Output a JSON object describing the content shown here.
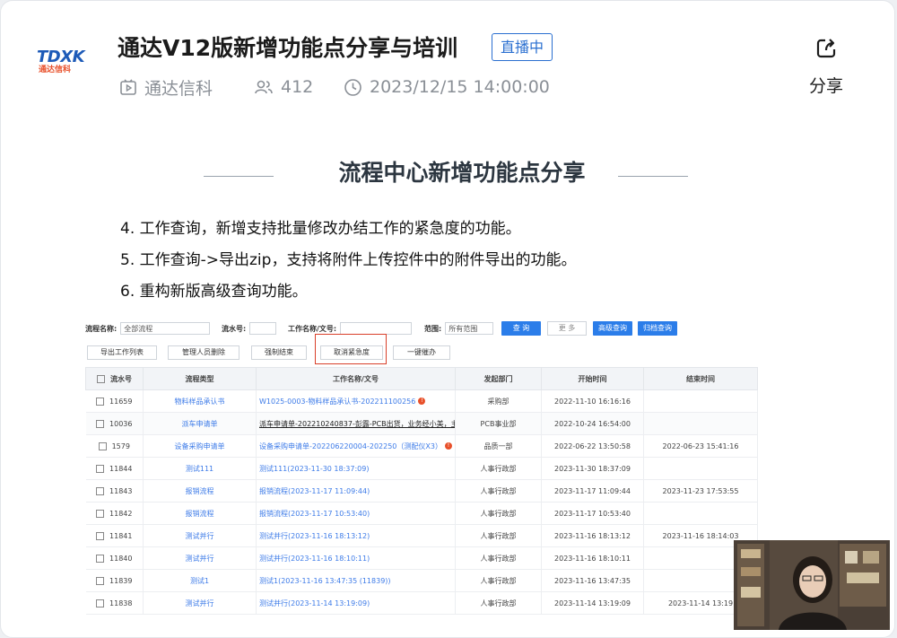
{
  "header": {
    "logo_text": "TDXK",
    "logo_sub": "通达信科",
    "title": "通达V12版新增功能点分享与培训",
    "live_badge": "直播中",
    "channel": "通达信科",
    "viewers": "412",
    "datetime": "2023/12/15 14:00:00",
    "share_label": "分享"
  },
  "slide": {
    "title": "流程中心新增功能点分享",
    "points": [
      "4. 工作查询，新增支持批量修改办结工作的紧急度的功能。",
      "5. 工作查询->导出zip，支持将附件上传控件中的附件导出的功能。",
      "6. 重构新版高级查询功能。"
    ]
  },
  "screenshot": {
    "search": {
      "flow_name_label": "流程名称:",
      "flow_name_value": "全部流程",
      "serial_label": "流水号:",
      "work_name_label": "工作名称/文号:",
      "scope_label": "范围:",
      "scope_value": "所有范围",
      "query_btn": "查 询",
      "more_btn": "更 多",
      "adv_btn": "高级查询",
      "archive_btn": "归档查询"
    },
    "actions": [
      "导出工作列表",
      "管理人员删除",
      "强制结束",
      "取消紧急度",
      "一键催办"
    ],
    "columns": [
      "流水号",
      "流程类型",
      "工作名称/文号",
      "发起部门",
      "开始时间",
      "结束时间"
    ],
    "rows": [
      {
        "id": "11659",
        "type": "物料样品承认书",
        "name": "W1025-0003-物料样品承认书-202211100256",
        "dept": "采购部",
        "start": "2022-11-10 16:16:16",
        "end": "",
        "badge": true,
        "dark": false
      },
      {
        "id": "10036",
        "type": "派车申请单",
        "name": "派车申请单-202210240837-彭露-PCB出货，业务经小美，主",
        "dept": "PCB事业部",
        "start": "2022-10-24 16:54:00",
        "end": "",
        "badge": false,
        "dark": true
      },
      {
        "id": "1579",
        "type": "设备采购申请单",
        "name": "设备采购申请单-202206220004-202250（测配仪X3）",
        "dept": "品质一部",
        "start": "2022-06-22 13:50:58",
        "end": "2022-06-23 15:41:16",
        "badge": true,
        "dark": false
      },
      {
        "id": "11844",
        "type": "测试111",
        "name": "测试111(2023-11-30 18:37:09)",
        "dept": "人事行政部",
        "start": "2023-11-30 18:37:09",
        "end": "",
        "badge": false,
        "dark": false
      },
      {
        "id": "11843",
        "type": "报销流程",
        "name": "报销流程(2023-11-17 11:09:44)",
        "dept": "人事行政部",
        "start": "2023-11-17 11:09:44",
        "end": "2023-11-23 17:53:55",
        "badge": false,
        "dark": false
      },
      {
        "id": "11842",
        "type": "报销流程",
        "name": "报销流程(2023-11-17 10:53:40)",
        "dept": "人事行政部",
        "start": "2023-11-17 10:53:40",
        "end": "",
        "badge": false,
        "dark": false
      },
      {
        "id": "11841",
        "type": "测试并行",
        "name": "测试并行(2023-11-16 18:13:12)",
        "dept": "人事行政部",
        "start": "2023-11-16 18:13:12",
        "end": "2023-11-16 18:14:03",
        "badge": false,
        "dark": false
      },
      {
        "id": "11840",
        "type": "测试并行",
        "name": "测试并行(2023-11-16 18:10:11)",
        "dept": "人事行政部",
        "start": "2023-11-16 18:10:11",
        "end": "",
        "badge": false,
        "dark": false
      },
      {
        "id": "11839",
        "type": "测试1",
        "name": "测试1(2023-11-16 13:47:35 (11839))",
        "dept": "人事行政部",
        "start": "2023-11-16 13:47:35",
        "end": "",
        "badge": false,
        "dark": false
      },
      {
        "id": "11838",
        "type": "测试并行",
        "name": "测试并行(2023-11-14 13:19:09)",
        "dept": "人事行政部",
        "start": "2023-11-14 13:19:09",
        "end": "2023-11-14 13:19",
        "badge": false,
        "dark": false
      }
    ]
  },
  "colors": {
    "accent": "#2a6fd0",
    "link": "#3d7be8",
    "highlight": "#d9402a"
  },
  "icons": [
    "play-icon",
    "users-icon",
    "clock-icon",
    "share-icon",
    "checkbox-icon",
    "urgent-badge-icon"
  ]
}
